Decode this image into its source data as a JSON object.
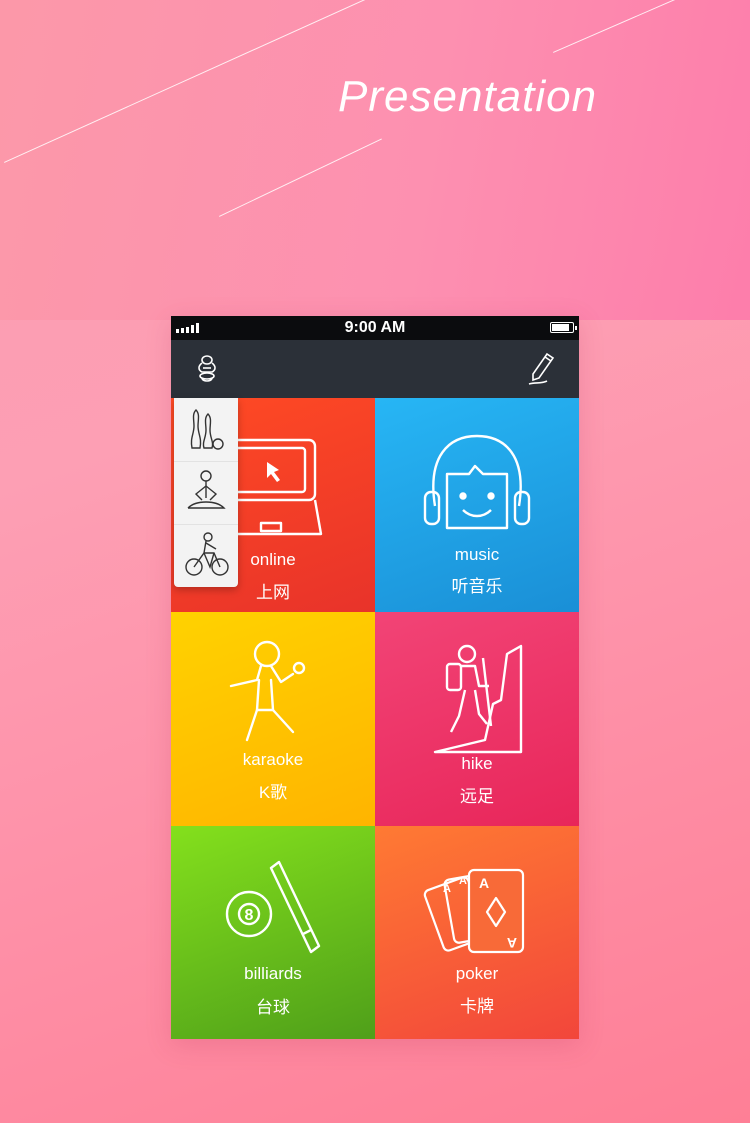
{
  "header": {
    "title": "Presentation"
  },
  "status_bar": {
    "time": "9:00 AM",
    "signal_bars": 5,
    "battery_level": 0.9
  },
  "nav": {
    "left_icon": "menu-bowling-icon",
    "right_icon": "pencil-edit-icon"
  },
  "dropdown": {
    "items": [
      {
        "icon": "bowling-icon"
      },
      {
        "icon": "meditation-icon"
      },
      {
        "icon": "cycling-icon"
      }
    ]
  },
  "tiles": [
    {
      "label_en": "online",
      "label_zh": "上网",
      "icon": "computer-icon",
      "color": "#ff4a24"
    },
    {
      "label_en": "music",
      "label_zh": "听音乐",
      "icon": "headphones-face-icon",
      "color": "#27b6f5"
    },
    {
      "label_en": "karaoke",
      "label_zh": "K歌",
      "icon": "singer-icon",
      "color": "#ffd200"
    },
    {
      "label_en": "hike",
      "label_zh": "远足",
      "icon": "climber-icon",
      "color": "#f24476"
    },
    {
      "label_en": "billiards",
      "label_zh": "台球",
      "icon": "billiard-ball-icon",
      "color": "#84e01c"
    },
    {
      "label_en": "poker",
      "label_zh": "卡牌",
      "icon": "playing-cards-icon",
      "color": "#ff7a33"
    }
  ]
}
